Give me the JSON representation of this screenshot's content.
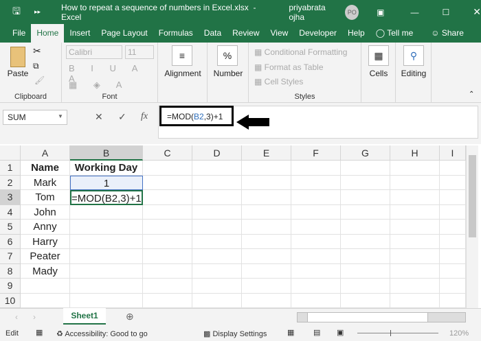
{
  "title": {
    "filename": "How to repeat a sequence of numbers in Excel.xlsx",
    "sep": "-",
    "app": "Excel",
    "user": "priyabrata ojha",
    "initials": "PO"
  },
  "tabs": [
    "File",
    "Home",
    "Insert",
    "Page Layout",
    "Formulas",
    "Data",
    "Review",
    "View",
    "Developer",
    "Help"
  ],
  "tell_me": "Tell me",
  "share": "Share",
  "ribbon": {
    "paste": "Paste",
    "clipboard": "Clipboard",
    "font_name": "Calibri",
    "font_size": "11",
    "font": "Font",
    "alignment": "Alignment",
    "number": "Number",
    "number_icon": "%",
    "conditional": "Conditional Formatting",
    "format_table": "Format as Table",
    "cell_styles": "Cell Styles",
    "styles": "Styles",
    "cells": "Cells",
    "editing": "Editing"
  },
  "formula": {
    "name_box": "SUM",
    "prefix": "=MOD(",
    "ref": "B2",
    "suffix": ",3)+1",
    "ref_color": "#2f6eba"
  },
  "columns": [
    "A",
    "B",
    "C",
    "D",
    "E",
    "F",
    "G",
    "H",
    "I"
  ],
  "rows": [
    [
      "Name",
      "Working Day"
    ],
    [
      "Mark",
      "1"
    ],
    [
      "Tom",
      "=MOD(B2,3)+1"
    ],
    [
      "John",
      ""
    ],
    [
      "Anny",
      ""
    ],
    [
      "Harry",
      ""
    ],
    [
      "Peater",
      ""
    ],
    [
      "Mady",
      ""
    ],
    [
      "",
      ""
    ],
    [
      "",
      ""
    ]
  ],
  "sheet": "Sheet1",
  "status": {
    "mode": "Edit",
    "accessibility": "Accessibility: Good to go",
    "display": "Display Settings",
    "zoom": "120%"
  }
}
